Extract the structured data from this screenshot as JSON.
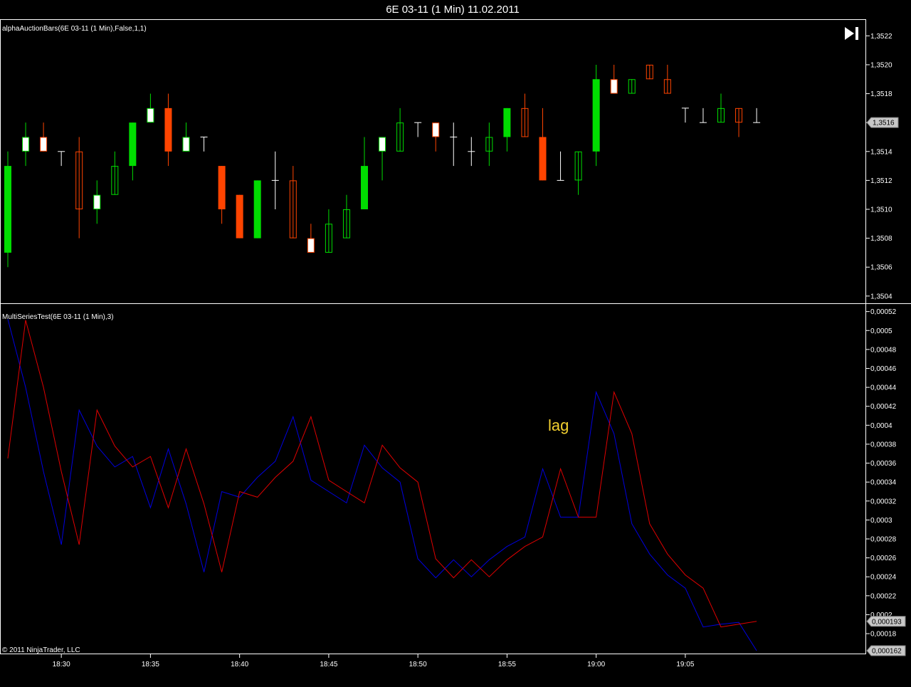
{
  "window": {
    "title": "6E 03-11 (1 Min)  11.02.2011"
  },
  "panel1": {
    "label": "alphaAuctionBars(6E 03-11 (1 Min),False,1,1)"
  },
  "panel2": {
    "label": "MultiSeriesTest(6E 03-11 (1 Min),3)"
  },
  "copyright": "© 2011 NinjaTrader, LLC",
  "annotation": "lag",
  "colors": {
    "bull": "#00dd00",
    "bear": "#ff4400",
    "neutral": "#ffffff",
    "blue_series": "#0000e0",
    "red_series": "#e00000",
    "grid_border": "#ffffff"
  },
  "icons": {
    "skip_end": "skip-to-end-icon"
  },
  "chart_data": [
    {
      "type": "candlestick",
      "title": "alphaAuctionBars(6E 03-11 (1 Min),False,1,1)",
      "ylim": [
        1.35035,
        1.35231
      ],
      "y_ticks": [
        "1,3504",
        "1,3506",
        "1,3508",
        "1,3510",
        "1,3512",
        "1,3514",
        "1,3516",
        "1,3518",
        "1,3520",
        "1,3522"
      ],
      "y_tick_values": [
        1.3504,
        1.3506,
        1.3508,
        1.351,
        1.3512,
        1.3514,
        1.3516,
        1.3518,
        1.352,
        1.3522
      ],
      "last_price_label": "1,3516",
      "last_price": 1.3516,
      "x_ticks": [
        "18:30",
        "18:35",
        "18:40",
        "18:45",
        "18:50",
        "18:55",
        "19:00",
        "19:05"
      ],
      "x_tick_index": [
        3,
        8,
        13,
        18,
        23,
        28,
        33,
        38
      ],
      "bars": [
        {
          "open": 1.3507,
          "high": 1.3514,
          "low": 1.3506,
          "close": 1.3513,
          "style": "bull_filled"
        },
        {
          "open": 1.3514,
          "high": 1.3516,
          "low": 1.3513,
          "close": 1.3515,
          "style": "bull_hollow_white"
        },
        {
          "open": 1.3515,
          "high": 1.3516,
          "low": 1.3514,
          "close": 1.3514,
          "style": "bear_hollow_white"
        },
        {
          "open": 1.3514,
          "high": 1.3514,
          "low": 1.3513,
          "close": 1.3514,
          "style": "doji"
        },
        {
          "open": 1.3514,
          "high": 1.3515,
          "low": 1.3508,
          "close": 1.351,
          "style": "bear_hollow"
        },
        {
          "open": 1.351,
          "high": 1.3512,
          "low": 1.3509,
          "close": 1.3511,
          "style": "bull_hollow_white"
        },
        {
          "open": 1.3511,
          "high": 1.3514,
          "low": 1.3511,
          "close": 1.3513,
          "style": "bull_hollow"
        },
        {
          "open": 1.3513,
          "high": 1.3516,
          "low": 1.3512,
          "close": 1.3516,
          "style": "bull_filled"
        },
        {
          "open": 1.3516,
          "high": 1.3518,
          "low": 1.3516,
          "close": 1.3517,
          "style": "bull_hollow_white"
        },
        {
          "open": 1.3517,
          "high": 1.3518,
          "low": 1.3513,
          "close": 1.3514,
          "style": "bear_filled"
        },
        {
          "open": 1.3514,
          "high": 1.3516,
          "low": 1.3514,
          "close": 1.3515,
          "style": "bull_hollow_white"
        },
        {
          "open": 1.3515,
          "high": 1.3515,
          "low": 1.3514,
          "close": 1.3514,
          "style": "doji"
        },
        {
          "open": 1.3513,
          "high": 1.3513,
          "low": 1.3509,
          "close": 1.351,
          "style": "bear_filled"
        },
        {
          "open": 1.3511,
          "high": 1.3511,
          "low": 1.3508,
          "close": 1.3508,
          "style": "bear_filled"
        },
        {
          "open": 1.3508,
          "high": 1.3512,
          "low": 1.3508,
          "close": 1.3512,
          "style": "bull_filled"
        },
        {
          "open": 1.3512,
          "high": 1.3514,
          "low": 1.351,
          "close": 1.3512,
          "style": "doji"
        },
        {
          "open": 1.3512,
          "high": 1.3513,
          "low": 1.3508,
          "close": 1.3508,
          "style": "bear_hollow"
        },
        {
          "open": 1.3508,
          "high": 1.3509,
          "low": 1.3507,
          "close": 1.3507,
          "style": "bear_hollow_white"
        },
        {
          "open": 1.3507,
          "high": 1.351,
          "low": 1.3507,
          "close": 1.3509,
          "style": "bull_hollow"
        },
        {
          "open": 1.3508,
          "high": 1.3511,
          "low": 1.3508,
          "close": 1.351,
          "style": "bull_hollow"
        },
        {
          "open": 1.351,
          "high": 1.3515,
          "low": 1.351,
          "close": 1.3513,
          "style": "bull_filled"
        },
        {
          "open": 1.3514,
          "high": 1.3515,
          "low": 1.3512,
          "close": 1.3515,
          "style": "bull_hollow_white"
        },
        {
          "open": 1.3514,
          "high": 1.3517,
          "low": 1.3514,
          "close": 1.3516,
          "style": "bull_hollow"
        },
        {
          "open": 1.3516,
          "high": 1.3516,
          "low": 1.3515,
          "close": 1.3516,
          "style": "doji"
        },
        {
          "open": 1.3516,
          "high": 1.3516,
          "low": 1.3514,
          "close": 1.3515,
          "style": "bear_hollow_white"
        },
        {
          "open": 1.3515,
          "high": 1.3516,
          "low": 1.3513,
          "close": 1.3515,
          "style": "doji"
        },
        {
          "open": 1.3514,
          "high": 1.3515,
          "low": 1.3513,
          "close": 1.3514,
          "style": "doji"
        },
        {
          "open": 1.3514,
          "high": 1.3516,
          "low": 1.3513,
          "close": 1.3515,
          "style": "bull_hollow"
        },
        {
          "open": 1.3515,
          "high": 1.3517,
          "low": 1.3514,
          "close": 1.3517,
          "style": "bull_filled"
        },
        {
          "open": 1.3517,
          "high": 1.3518,
          "low": 1.3515,
          "close": 1.3515,
          "style": "bear_hollow"
        },
        {
          "open": 1.3515,
          "high": 1.3517,
          "low": 1.3512,
          "close": 1.3512,
          "style": "bear_filled"
        },
        {
          "open": 1.3512,
          "high": 1.3514,
          "low": 1.3512,
          "close": 1.3512,
          "style": "doji"
        },
        {
          "open": 1.3512,
          "high": 1.3514,
          "low": 1.3511,
          "close": 1.3514,
          "style": "bull_hollow"
        },
        {
          "open": 1.3514,
          "high": 1.352,
          "low": 1.3513,
          "close": 1.3519,
          "style": "bull_filled"
        },
        {
          "open": 1.3519,
          "high": 1.352,
          "low": 1.3518,
          "close": 1.3518,
          "style": "bear_hollow_white"
        },
        {
          "open": 1.3518,
          "high": 1.3519,
          "low": 1.3518,
          "close": 1.3519,
          "style": "bull_hollow"
        },
        {
          "open": 1.3519,
          "high": 1.352,
          "low": 1.3519,
          "close": 1.352,
          "style": "bear_hollow"
        },
        {
          "open": 1.3519,
          "high": 1.352,
          "low": 1.3518,
          "close": 1.3518,
          "style": "bear_hollow"
        },
        {
          "open": 1.3517,
          "high": 1.3517,
          "low": 1.3516,
          "close": 1.3517,
          "style": "doji"
        },
        {
          "open": 1.3516,
          "high": 1.3517,
          "low": 1.3516,
          "close": 1.3516,
          "style": "doji"
        },
        {
          "open": 1.3516,
          "high": 1.3518,
          "low": 1.3516,
          "close": 1.3517,
          "style": "bull_hollow"
        },
        {
          "open": 1.3517,
          "high": 1.3517,
          "low": 1.3515,
          "close": 1.3516,
          "style": "bear_hollow"
        },
        {
          "open": 1.3516,
          "high": 1.3517,
          "low": 1.3516,
          "close": 1.3516,
          "style": "doji"
        }
      ]
    },
    {
      "type": "line",
      "title": "MultiSeriesTest(6E 03-11 (1 Min),3)",
      "ylim": [
        0.000159,
        0.000528
      ],
      "y_ticks": [
        "0,00018",
        "0,0002",
        "0,00022",
        "0,00024",
        "0,00026",
        "0,00028",
        "0,0003",
        "0,00032",
        "0,00034",
        "0,00036",
        "0,00038",
        "0,0004",
        "0,00042",
        "0,00044",
        "0,00046",
        "0,00048",
        "0,0005",
        "0,00052"
      ],
      "y_tick_values": [
        0.00018,
        0.0002,
        0.00022,
        0.00024,
        0.00026,
        0.00028,
        0.0003,
        0.00032,
        0.00034,
        0.00036,
        0.00038,
        0.0004,
        0.00042,
        0.00044,
        0.00046,
        0.00048,
        0.0005,
        0.00052
      ],
      "series": [
        {
          "color": "#0000e0",
          "last_label": "0,000162",
          "points": [
            [
              0,
              0.000512
            ],
            [
              1,
              0.00044
            ],
            [
              2,
              0.000351
            ],
            [
              3,
              0.000274
            ],
            [
              4,
              0.000416
            ],
            [
              5,
              0.000378
            ],
            [
              6,
              0.000356
            ],
            [
              7,
              0.000367
            ],
            [
              8,
              0.000313
            ],
            [
              9,
              0.000375
            ],
            [
              10,
              0.000317
            ],
            [
              11,
              0.000245
            ],
            [
              12,
              0.00033
            ],
            [
              13,
              0.000324
            ],
            [
              14,
              0.000345
            ],
            [
              15,
              0.000362
            ],
            [
              16,
              0.000409
            ],
            [
              17,
              0.000342
            ],
            [
              18,
              0.00033
            ],
            [
              19,
              0.000318
            ],
            [
              20,
              0.000379
            ],
            [
              21,
              0.000355
            ],
            [
              22,
              0.00034
            ],
            [
              23,
              0.000259
            ],
            [
              24,
              0.000239
            ],
            [
              25,
              0.000258
            ],
            [
              26,
              0.00024
            ],
            [
              27,
              0.000258
            ],
            [
              28,
              0.000272
            ],
            [
              29,
              0.000282
            ],
            [
              30,
              0.000354
            ],
            [
              31,
              0.000303
            ],
            [
              32,
              0.000303
            ],
            [
              33,
              0.000435
            ],
            [
              34,
              0.000391
            ],
            [
              35,
              0.000296
            ],
            [
              36,
              0.000264
            ],
            [
              37,
              0.000242
            ],
            [
              38,
              0.000228
            ],
            [
              39,
              0.000187
            ],
            [
              40,
              0.00019
            ],
            [
              41,
              0.000192
            ],
            [
              42,
              0.000162
            ]
          ]
        },
        {
          "color": "#e00000",
          "last_label": "0,000193",
          "points": [
            [
              0,
              0.000365
            ],
            [
              1,
              0.000511
            ],
            [
              2,
              0.00044
            ],
            [
              3,
              0.000351
            ],
            [
              4,
              0.000274
            ],
            [
              5,
              0.000416
            ],
            [
              6,
              0.000378
            ],
            [
              7,
              0.000356
            ],
            [
              8,
              0.000367
            ],
            [
              9,
              0.000313
            ],
            [
              10,
              0.000375
            ],
            [
              11,
              0.000317
            ],
            [
              12,
              0.000245
            ],
            [
              13,
              0.00033
            ],
            [
              14,
              0.000324
            ],
            [
              15,
              0.000345
            ],
            [
              16,
              0.000362
            ],
            [
              17,
              0.000409
            ],
            [
              18,
              0.000342
            ],
            [
              19,
              0.00033
            ],
            [
              20,
              0.000318
            ],
            [
              21,
              0.000379
            ],
            [
              22,
              0.000355
            ],
            [
              23,
              0.00034
            ],
            [
              24,
              0.000259
            ],
            [
              25,
              0.000239
            ],
            [
              26,
              0.000258
            ],
            [
              27,
              0.00024
            ],
            [
              28,
              0.000258
            ],
            [
              29,
              0.000272
            ],
            [
              30,
              0.000282
            ],
            [
              31,
              0.000354
            ],
            [
              32,
              0.000303
            ],
            [
              33,
              0.000303
            ],
            [
              34,
              0.000435
            ],
            [
              35,
              0.000391
            ],
            [
              36,
              0.000296
            ],
            [
              37,
              0.000264
            ],
            [
              38,
              0.000242
            ],
            [
              39,
              0.000228
            ],
            [
              40,
              0.000187
            ],
            [
              41,
              0.00019
            ],
            [
              42,
              0.000193
            ]
          ]
        }
      ]
    }
  ]
}
